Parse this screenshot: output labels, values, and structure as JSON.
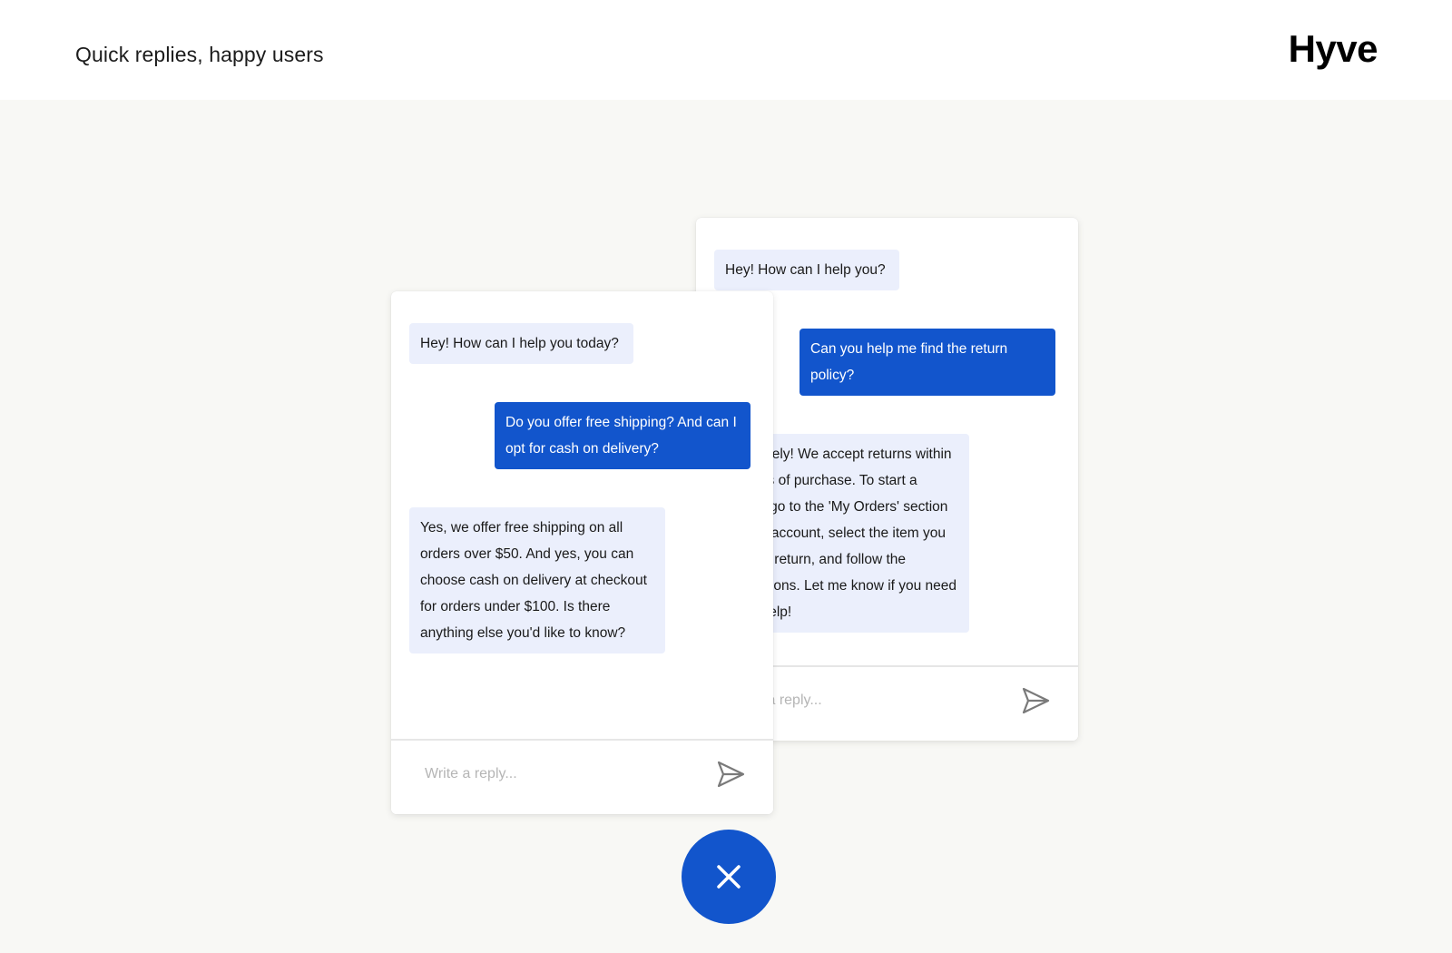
{
  "header": {
    "tagline": "Quick replies, happy users",
    "brand": "Hyve"
  },
  "chat_back": {
    "messages": [
      {
        "role": "bot",
        "text": "Hey! How can I help you?"
      },
      {
        "role": "user",
        "text": "Can you help me find the return policy?"
      },
      {
        "role": "bot",
        "text": "Absolutely! We accept returns within 30 days of purchase. To start a return, go to the 'My Orders' section in your account, select the item you want to return, and follow the instructions. Let me know if you need more help!"
      }
    ],
    "composer_placeholder": "Write a reply..."
  },
  "chat_front": {
    "messages": [
      {
        "role": "bot",
        "text": "Hey! How can I help you today?"
      },
      {
        "role": "user",
        "text": "Do you offer free shipping? And can I opt for cash on delivery?"
      },
      {
        "role": "bot",
        "text": "Yes, we offer free shipping on all orders over $50. And yes, you can choose cash on delivery at checkout for orders under $100. Is there anything else you'd like to know?"
      }
    ],
    "composer_placeholder": "Write a reply..."
  },
  "icons": {
    "send": "send-icon",
    "close": "close-icon"
  },
  "colors": {
    "accent": "#1255cc",
    "bot_bubble": "#ebeffc",
    "stage_bg": "#f8f8f5"
  }
}
